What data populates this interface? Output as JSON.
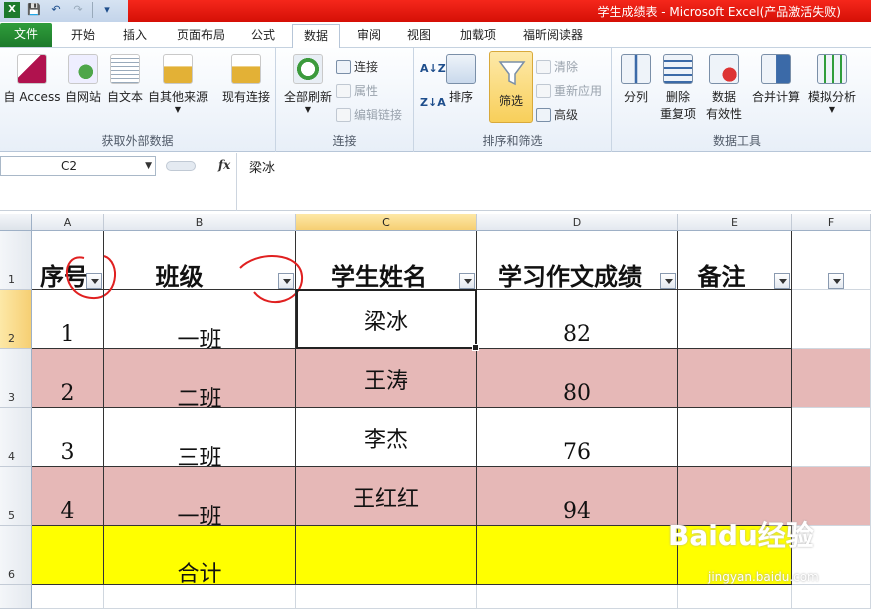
{
  "window": {
    "title": "学生成绩表 - Microsoft Excel(产品激活失败)"
  },
  "tabs": [
    "文件",
    "开始",
    "插入",
    "页面布局",
    "公式",
    "数据",
    "审阅",
    "视图",
    "加载项",
    "福昕阅读器"
  ],
  "active_tab": "数据",
  "ribbon": {
    "external_data": {
      "label": "获取外部数据",
      "buttons": [
        "自 Access",
        "自网站",
        "自文本",
        "自其他来源",
        "现有连接"
      ]
    },
    "connections": {
      "label": "连接",
      "refresh_all": "全部刷新",
      "small": [
        "连接",
        "属性",
        "编辑链接"
      ]
    },
    "sort_filter": {
      "label": "排序和筛选",
      "sort": "排序",
      "filter": "筛选",
      "small": [
        "清除",
        "重新应用",
        "高级"
      ]
    },
    "data_tools": {
      "label": "数据工具",
      "text_to_columns": "分列",
      "remove_duplicates_1": "删除",
      "remove_duplicates_2": "重复项",
      "validation_1": "数据",
      "validation_2": "有效性",
      "consolidate": "合并计算",
      "whatif": "模拟分析"
    }
  },
  "formula_bar": {
    "cell_ref": "C2",
    "fx": "fx",
    "content": "梁冰"
  },
  "columns": [
    "A",
    "B",
    "C",
    "D",
    "E",
    "F"
  ],
  "rows": [
    "1",
    "2",
    "3",
    "4",
    "5",
    "6"
  ],
  "sheet": {
    "headers": [
      "序号",
      "班级",
      "学生姓名",
      "学习作文成绩",
      "备注"
    ],
    "data": [
      [
        "1",
        "一班",
        "梁冰",
        "82",
        ""
      ],
      [
        "2",
        "二班",
        "王涛",
        "80",
        ""
      ],
      [
        "3",
        "三班",
        "李杰",
        "76",
        ""
      ],
      [
        "4",
        "一班",
        "王红红",
        "94",
        ""
      ]
    ],
    "total_label": "合计"
  },
  "watermark": {
    "brand": "Baidu经验",
    "url": "jingyan.baidu.com"
  },
  "colors": {
    "pink_row": "#e6b8b7",
    "total_row": "#ffff00",
    "file_tab": "#1d7a2b",
    "title_bar": "#d50f06",
    "annotation": "#e02020"
  }
}
